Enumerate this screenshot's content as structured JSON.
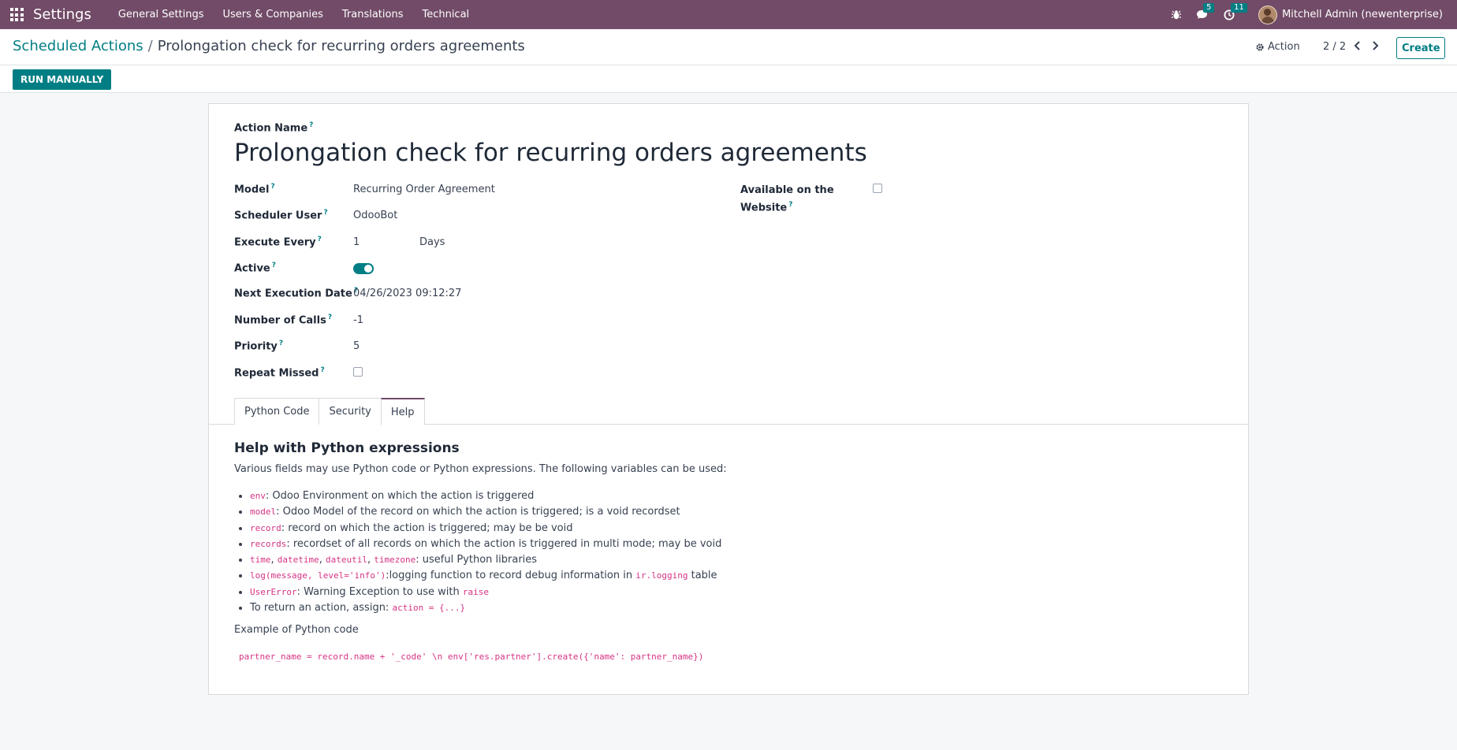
{
  "navbar": {
    "app_name": "Settings",
    "menu": [
      "General Settings",
      "Users & Companies",
      "Translations",
      "Technical"
    ],
    "messages_count": "5",
    "activities_count": "11",
    "user_name": "Mitchell Admin (newenterprise)"
  },
  "control": {
    "breadcrumb_parent": "Scheduled Actions",
    "breadcrumb_separator": "/",
    "breadcrumb_current": "Prolongation check for recurring orders agreements",
    "action_label": "Action",
    "pager": "2 / 2",
    "create_label": "Create"
  },
  "statusbar": {
    "run_label": "RUN MANUALLY"
  },
  "form": {
    "action_name_label": "Action Name",
    "action_name": "Prolongation check for recurring orders agreements",
    "model_label": "Model",
    "model_value": "Recurring Order Agreement",
    "scheduler_user_label": "Scheduler User",
    "scheduler_user_value": "OdooBot",
    "execute_every_label": "Execute Every",
    "execute_every_value": "1",
    "execute_every_unit": "Days",
    "active_label": "Active",
    "active_value": true,
    "next_exec_label": "Next Execution Date",
    "next_exec_value": "04/26/2023 09:12:27",
    "num_calls_label": "Number of Calls",
    "num_calls_value": "-1",
    "priority_label": "Priority",
    "priority_value": "5",
    "repeat_missed_label": "Repeat Missed",
    "repeat_missed_value": false,
    "website_label_line1": "Available on the",
    "website_label_line2": "Website",
    "website_value": false,
    "tooltip_mark": "?"
  },
  "tabs": [
    {
      "label": "Python Code",
      "active": false
    },
    {
      "label": "Security",
      "active": false
    },
    {
      "label": "Help",
      "active": true
    }
  ],
  "help": {
    "title": "Help with Python expressions",
    "intro": "Various fields may use Python code or Python expressions. The following variables can be used:",
    "items": {
      "env_code": "env",
      "env_text": ": Odoo Environment on which the action is triggered",
      "model_code": "model",
      "model_text": ": Odoo Model of the record on which the action is triggered; is a void recordset",
      "record_code": "record",
      "record_text": ": record on which the action is triggered; may be be void",
      "records_code": "records",
      "records_text": ": recordset of all records on which the action is triggered in multi mode; may be void",
      "time_code": "time",
      "datetime_code": "datetime",
      "dateutil_code": "dateutil",
      "timezone_code": "timezone",
      "libs_text": ": useful Python libraries",
      "log_code": "log(message, level='info')",
      "log_text": ":logging function to record debug information in ",
      "irlog_code": "ir.logging",
      "table_text": " table",
      "usererror_code": "UserError",
      "usererror_text": ": Warning Exception to use with ",
      "raise_code": "raise",
      "return_text": "To return an action, assign: ",
      "action_code": "action = {...}"
    },
    "example_label": "Example of Python code",
    "example_code": "partner_name = record.name + '_code' \\n env['res.partner'].create({'name': partner_name})"
  }
}
